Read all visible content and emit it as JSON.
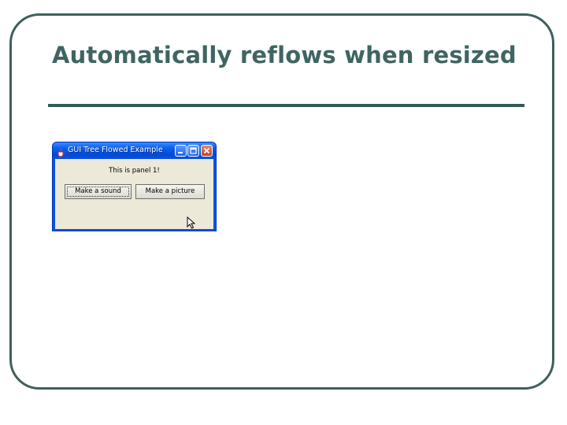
{
  "slide": {
    "title": "Automatically reflows when resized",
    "colors": {
      "title": "#3f6562",
      "frame_border": "#3f5f5c",
      "rule": "#345a57"
    }
  },
  "window": {
    "title": "GUI Tree Flowed Example",
    "icon": "java-cup-icon",
    "controls": [
      "minimize-icon",
      "maximize-icon",
      "close-icon"
    ],
    "panel_label": "This is panel 1!",
    "buttons": {
      "sound": "Make a sound",
      "picture": "Make a picture"
    },
    "colors": {
      "titlebar": "#0a55e0",
      "client_bg": "#ece9d8",
      "close_button": "#c9411f"
    }
  }
}
